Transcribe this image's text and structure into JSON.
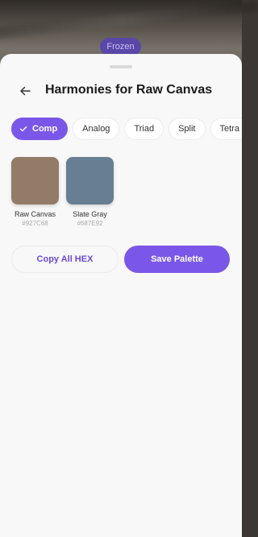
{
  "camera": {
    "status_pill": "Frozen"
  },
  "sheet": {
    "title": "Harmonies for Raw Canvas",
    "back_icon": "arrow-left-icon"
  },
  "harmony_tabs": [
    {
      "label": "Comp",
      "selected": true
    },
    {
      "label": "Analog",
      "selected": false
    },
    {
      "label": "Triad",
      "selected": false
    },
    {
      "label": "Split",
      "selected": false
    },
    {
      "label": "Tetra",
      "selected": false
    }
  ],
  "swatches": [
    {
      "name": "Raw Canvas",
      "hex": "#927C68",
      "color": "#927C68"
    },
    {
      "name": "Slate Gray",
      "hex": "#687E92",
      "color": "#687E92"
    }
  ],
  "actions": {
    "copy_label": "Copy All HEX",
    "save_label": "Save Palette"
  },
  "colors": {
    "accent": "#7A57E8",
    "sheet_bg": "#F8F8F8"
  }
}
